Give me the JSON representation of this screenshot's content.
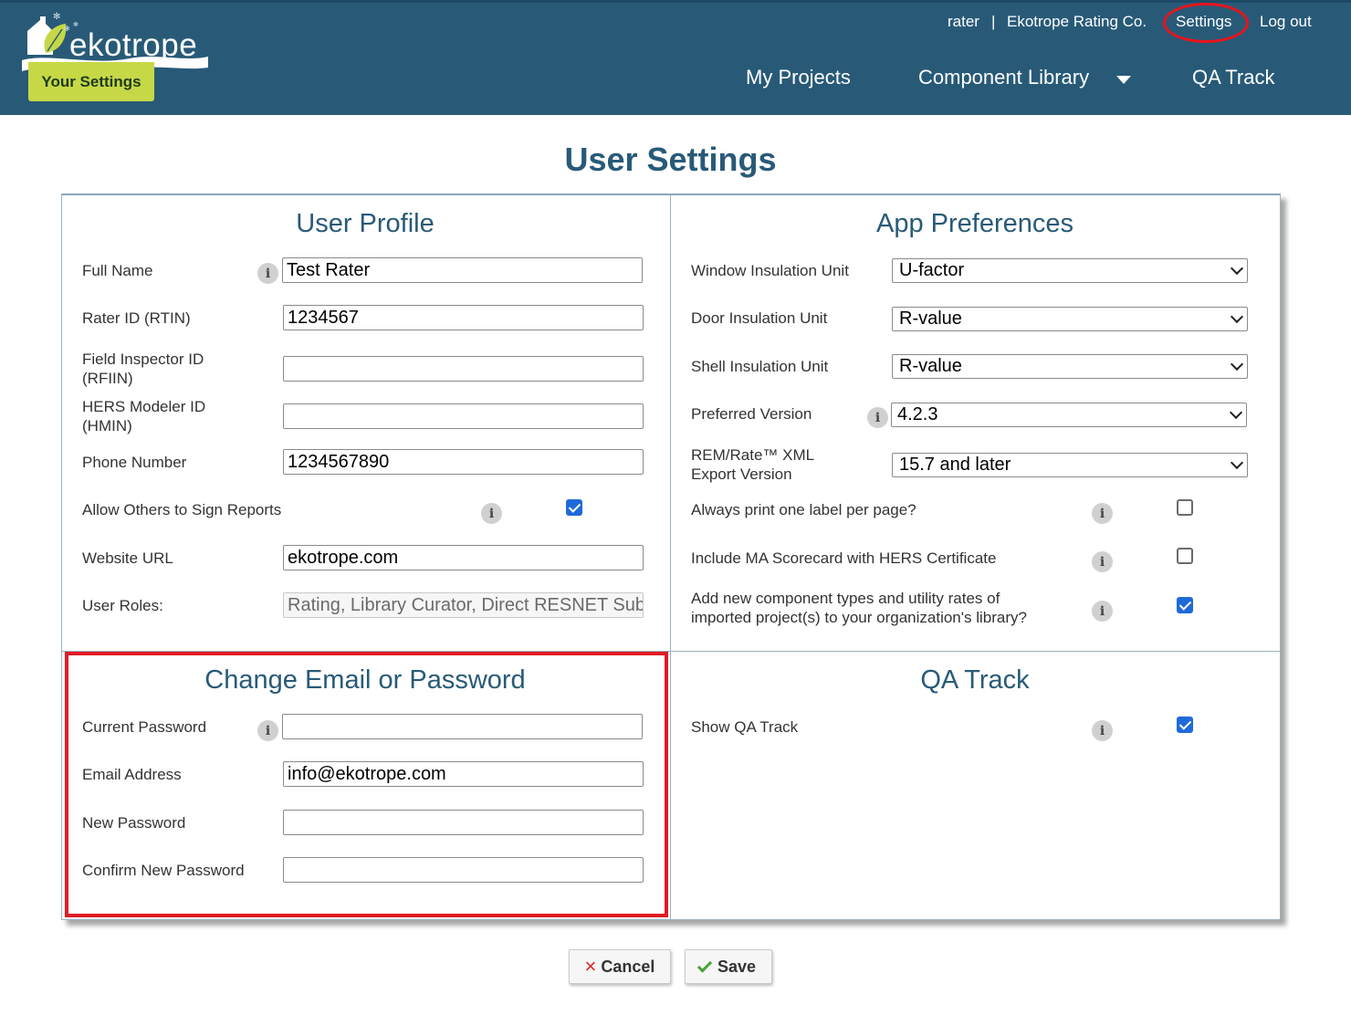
{
  "brand": {
    "logo_text": "ekotrope",
    "badge_label": "Your Settings"
  },
  "top_links": {
    "user": "rater",
    "separator": "|",
    "company": "Ekotrope Rating Co.",
    "settings": "Settings",
    "logout": "Log out"
  },
  "main_nav": {
    "my_projects": "My Projects",
    "component_library": "Component Library",
    "qa_track": "QA Track"
  },
  "page_title": "User Settings",
  "user_profile": {
    "title": "User Profile",
    "full_name_label": "Full Name",
    "full_name_value": "Test Rater",
    "rater_id_label": "Rater ID (RTIN)",
    "rater_id_value": "1234567",
    "field_inspector_label_1": "Field Inspector ID",
    "field_inspector_label_2": "(RFIIN)",
    "field_inspector_value": "",
    "hers_modeler_label_1": "HERS Modeler ID",
    "hers_modeler_label_2": "(HMIN)",
    "hers_modeler_value": "",
    "phone_label": "Phone Number",
    "phone_value": "1234567890",
    "allow_sign_label": "Allow Others to Sign Reports",
    "allow_sign_checked": true,
    "website_label": "Website URL",
    "website_value": "ekotrope.com",
    "roles_label": "User Roles:",
    "roles_value": "Rating, Library Curator, Direct RESNET Sub"
  },
  "app_preferences": {
    "title": "App Preferences",
    "window_unit_label": "Window Insulation Unit",
    "window_unit_value": "U-factor",
    "door_unit_label": "Door Insulation Unit",
    "door_unit_value": "R-value",
    "shell_unit_label": "Shell Insulation Unit",
    "shell_unit_value": "R-value",
    "preferred_version_label": "Preferred Version",
    "preferred_version_value": "4.2.3",
    "remrate_label_1": "REM/Rate™ XML",
    "remrate_label_2": "Export Version",
    "remrate_value": "15.7 and later",
    "one_label_label": "Always print one label per page?",
    "one_label_checked": false,
    "ma_scorecard_label": "Include MA Scorecard with HERS Certificate",
    "ma_scorecard_checked": false,
    "add_types_label_1": "Add new component types and utility rates of",
    "add_types_label_2": "imported project(s) to your organization's library?",
    "add_types_checked": true
  },
  "change_credentials": {
    "title": "Change Email or Password",
    "current_password_label": "Current Password",
    "current_password_value": "",
    "email_label": "Email Address",
    "email_value": "info@ekotrope.com",
    "new_password_label": "New Password",
    "new_password_value": "",
    "confirm_password_label": "Confirm New Password",
    "confirm_password_value": ""
  },
  "qa_track_section": {
    "title": "QA Track",
    "show_label": "Show QA Track",
    "show_checked": true
  },
  "info_glyph": "i",
  "buttons": {
    "cancel": "Cancel",
    "cancel_icon": "×",
    "save": "Save"
  },
  "colors": {
    "header_bg": "#285a78",
    "accent_green": "#c6d846",
    "title_blue": "#285a78",
    "highlight_red": "#e01b24",
    "checkbox_blue": "#1f6ad9"
  }
}
